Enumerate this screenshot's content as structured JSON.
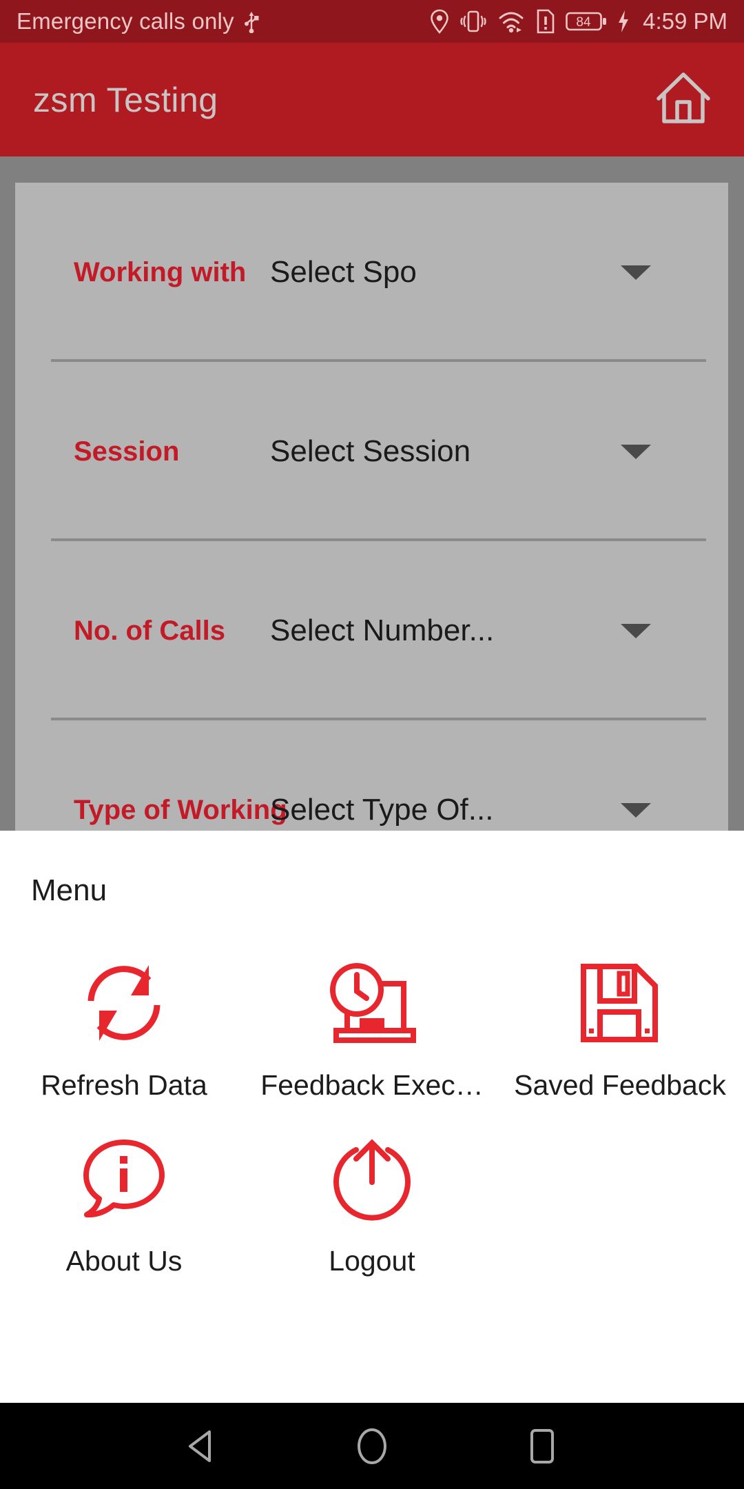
{
  "status_bar": {
    "carrier_text": "Emergency calls only",
    "time": "4:59 PM",
    "battery_level": "84",
    "icons": [
      "usb-icon",
      "location-icon",
      "vibrate-icon",
      "wifi-icon",
      "sim-alert-icon",
      "battery-icon",
      "charging-bolt-icon"
    ],
    "text_color": "#EEC6C6",
    "background_color": "#8E161C"
  },
  "app_bar": {
    "title": "zsm  Testing",
    "home_icon": "home-icon",
    "background_color": "#B01A21",
    "title_color": "#C9C5C5"
  },
  "form": {
    "label_color": "#C21A26",
    "card_background": "#B4B4B4",
    "rows": [
      {
        "label": "Working with",
        "value": "Select Spo"
      },
      {
        "label": "Session",
        "value": "Select Session"
      },
      {
        "label": "No. of Calls",
        "value": "Select Number..."
      },
      {
        "label": "Type of Working",
        "value": "Select Type Of..."
      }
    ]
  },
  "menu": {
    "title": "Menu",
    "accent_color": "#E8262D",
    "items": [
      {
        "label": "Refresh Data",
        "icon": "refresh-icon"
      },
      {
        "label": "Feedback Exec…",
        "icon": "clock-laptop-icon"
      },
      {
        "label": "Saved Feedback",
        "icon": "floppy-disk-icon"
      },
      {
        "label": "About Us",
        "icon": "info-bubble-icon"
      },
      {
        "label": "Logout",
        "icon": "power-logout-icon"
      }
    ]
  },
  "nav_bar": {
    "buttons": [
      "back-icon",
      "home-icon",
      "recents-icon"
    ],
    "background_color": "#000000"
  }
}
